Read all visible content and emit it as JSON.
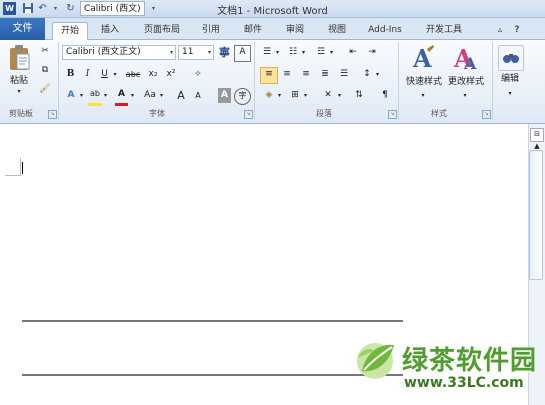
{
  "window": {
    "title": "文档1 - Microsoft Word",
    "qat_font_value": "Calibri (西文)"
  },
  "tabs": [
    {
      "label": "文件"
    },
    {
      "label": "开始"
    },
    {
      "label": "插入"
    },
    {
      "label": "页面布局"
    },
    {
      "label": "引用"
    },
    {
      "label": "邮件"
    },
    {
      "label": "审阅"
    },
    {
      "label": "视图"
    },
    {
      "label": "Add-Ins"
    },
    {
      "label": "开发工具"
    }
  ],
  "ribbon": {
    "clipboard": {
      "group_label": "剪贴板",
      "paste_label": "粘贴"
    },
    "font": {
      "group_label": "字体",
      "font_name": "Calibri (西文正文)",
      "font_size": "11",
      "bold": "B",
      "italic": "I",
      "underline": "U",
      "strike": "abc",
      "subscript": "x₂",
      "superscript": "x²",
      "grow": "A",
      "shrink": "A",
      "change_case": "Aa",
      "char_border": "A",
      "phonetic": "字"
    },
    "paragraph": {
      "group_label": "段落"
    },
    "styles": {
      "group_label": "样式",
      "quick_styles": "快速样式",
      "change_styles": "更改样式"
    },
    "editing": {
      "label": "编辑"
    }
  },
  "watermark": {
    "title": "绿茶软件园",
    "url": "www.33LC.com"
  },
  "colors": {
    "file_tab": "#2a5ea8",
    "highlight_yellow": "#f5e93a",
    "font_red": "#d62020",
    "watermark_green": "#4f9e2d"
  }
}
